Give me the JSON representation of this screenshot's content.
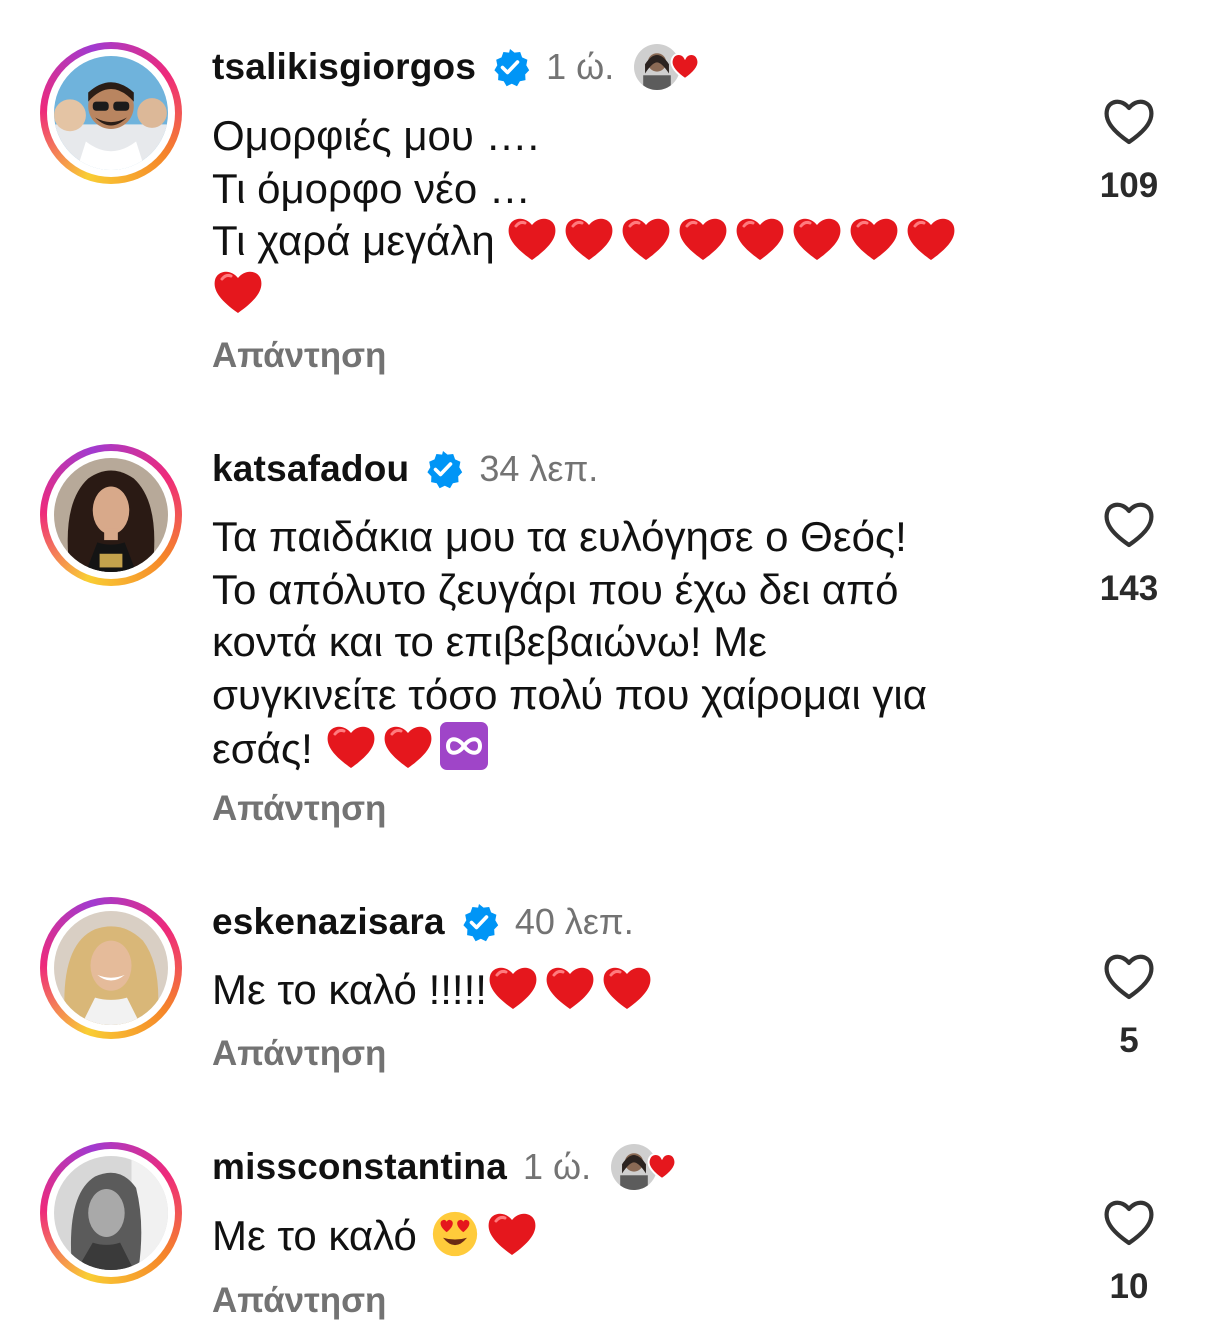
{
  "comments": [
    {
      "username": "tsalikisgiorgos",
      "verified": true,
      "time": "1 ώ.",
      "liked_by_creator": true,
      "lines": [
        "Ομορφιές μου ….",
        "Τι όμορφο νέο …",
        "Τι χαρά μεγάλη"
      ],
      "emojis": [
        "red-heart",
        "red-heart",
        "red-heart",
        "red-heart",
        "red-heart",
        "red-heart",
        "red-heart",
        "red-heart",
        "red-heart"
      ],
      "reply_label": "Απάντηση",
      "likes": "109"
    },
    {
      "username": "katsafadou",
      "verified": true,
      "time": "34 λεπ.",
      "liked_by_creator": false,
      "lines": [
        "Τα παιδάκια μου τα ευλόγησε ο Θεός!",
        "Το απόλυτο ζευγάρι που έχω δει από",
        "κοντά και το επιβεβαιώνω! Με",
        "συγκινείτε τόσο πολύ που χαίρομαι για",
        "εσάς!"
      ],
      "emojis": [
        "red-heart",
        "red-heart",
        "infinity"
      ],
      "reply_label": "Απάντηση",
      "likes": "143"
    },
    {
      "username": "eskenazisara",
      "verified": true,
      "time": "40 λεπ.",
      "liked_by_creator": false,
      "lines": [
        "Με το καλό !!!!!"
      ],
      "emojis": [
        "red-heart",
        "red-heart",
        "red-heart"
      ],
      "reply_label": "Απάντηση",
      "likes": "5"
    },
    {
      "username": "missconstantina",
      "verified": false,
      "time": "1 ώ.",
      "liked_by_creator": true,
      "lines": [
        "Με το καλό"
      ],
      "emojis": [
        "heart-eyes-face",
        "red-heart"
      ],
      "reply_label": "Απάντηση",
      "likes": "10"
    }
  ],
  "colors": {
    "text": "#111111",
    "muted": "#737373",
    "verified_blue": "#0095f6",
    "heart_red": "#e5171d",
    "story_ring": [
      "#f9ce34",
      "#ee2a7b",
      "#a13bd0"
    ]
  }
}
